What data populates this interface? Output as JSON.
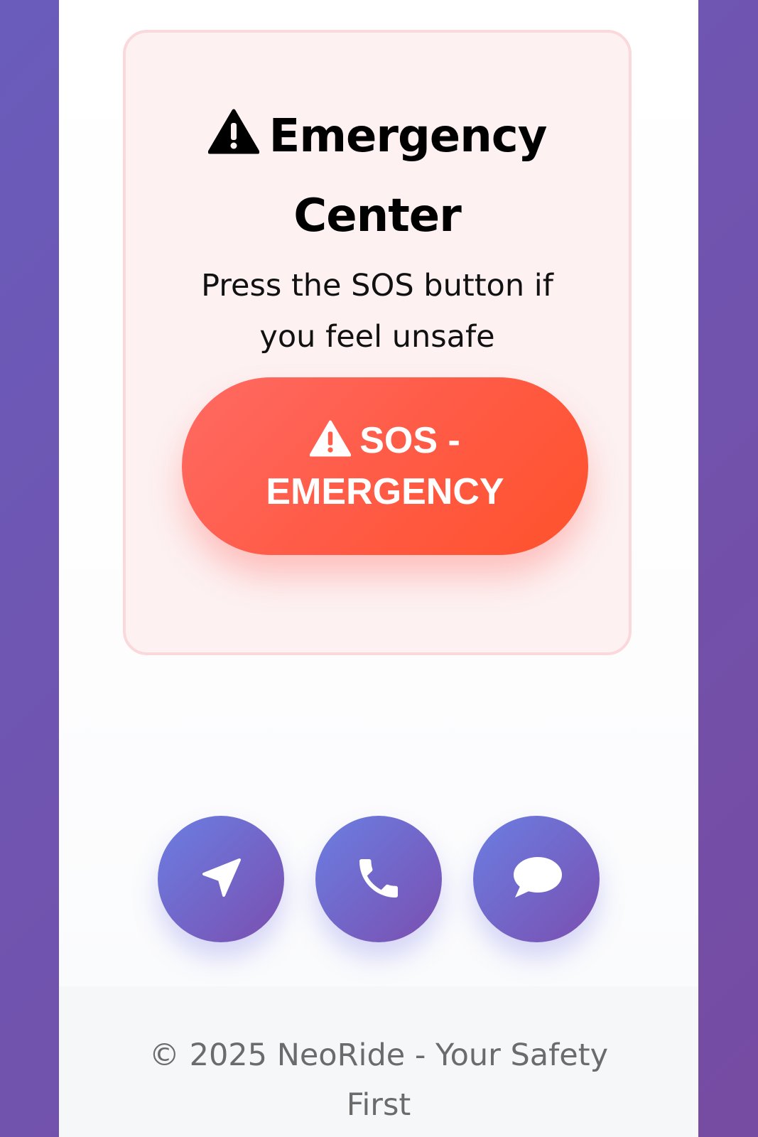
{
  "emergency": {
    "title": "Emergency Center",
    "subtitle": "Press the SOS button if you feel unsafe",
    "sos_label": "SOS - EMERGENCY"
  },
  "actions": [
    {
      "icon": "navigation-arrow-icon"
    },
    {
      "icon": "phone-icon"
    },
    {
      "icon": "chat-bubble-icon"
    }
  ],
  "footer": {
    "text": "© 2025 NeoRide - Your Safety First"
  },
  "colors": {
    "background_gradient_start": "#6a5cbb",
    "background_gradient_end": "#764ba2",
    "sos_gradient_start": "#ff6a63",
    "sos_gradient_end": "#ff522c",
    "card_background": "#fdf1f2",
    "card_border": "#fbd8da",
    "action_gradient_start": "#6b7ee2",
    "action_gradient_end": "#7a4fb0"
  }
}
